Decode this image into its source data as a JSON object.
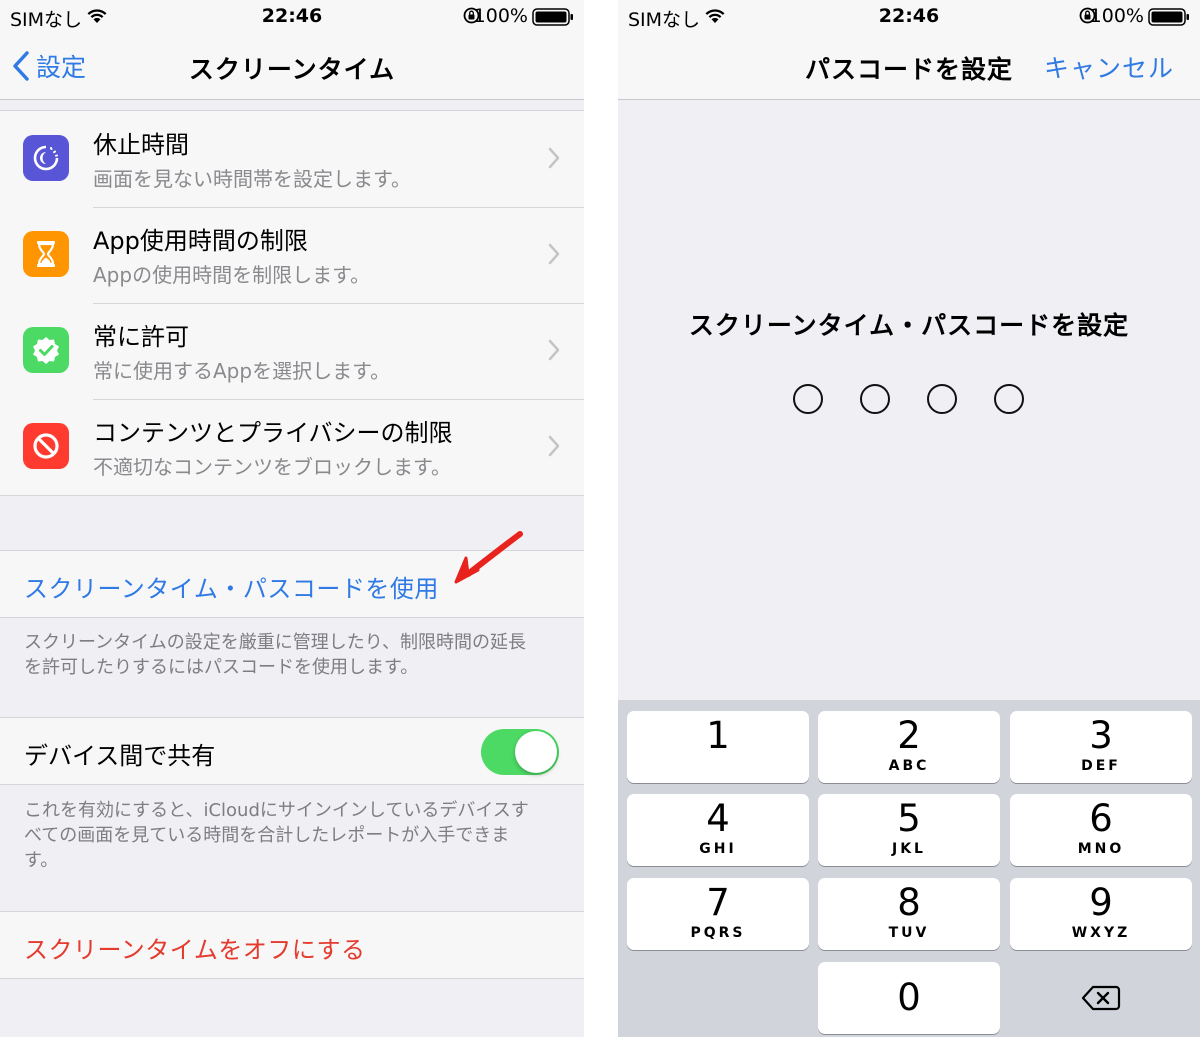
{
  "left": {
    "status": {
      "carrier": "SIMなし",
      "time": "22:46",
      "battery": "100%"
    },
    "nav": {
      "back_label": "設定",
      "title": "スクリーンタイム"
    },
    "features": [
      {
        "title": "休止時間",
        "subtitle": "画面を見ない時間帯を設定します。",
        "icon": "downtime-icon",
        "color": "#5856d6"
      },
      {
        "title": "App使用時間の制限",
        "subtitle": "Appの使用時間を制限します。",
        "icon": "hourglass-icon",
        "color": "#ff9500"
      },
      {
        "title": "常に許可",
        "subtitle": "常に使用するAppを選択します。",
        "icon": "checkmark-badge-icon",
        "color": "#4cd964"
      },
      {
        "title": "コンテンツとプライバシーの制限",
        "subtitle": "不適切なコンテンツをブロックします。",
        "icon": "prohibited-icon",
        "color": "#ff3b30"
      }
    ],
    "passcode_link": "スクリーンタイム・パスコードを使用",
    "passcode_footnote_line1": "スクリーンタイムの設定を厳重に管理したり、制限時間の延長",
    "passcode_footnote_line2": "を許可したりするにはパスコードを使用します。",
    "share_label": "デバイス間で共有",
    "share_enabled": true,
    "share_footnote_line1": "これを有効にすると、iCloudにサインインしているデバイスす",
    "share_footnote_line2": "べての画面を見ている時間を合計したレポートが入手できま",
    "share_footnote_line3": "す。",
    "turn_off_link": "スクリーンタイムをオフにする"
  },
  "right": {
    "status": {
      "carrier": "SIMなし",
      "time": "22:46",
      "battery": "100%"
    },
    "nav": {
      "title": "パスコードを設定",
      "cancel_label": "キャンセル"
    },
    "prompt": "スクリーンタイム・パスコードを設定",
    "passcode_length": 4,
    "keys": [
      {
        "digit": "1",
        "letters": ""
      },
      {
        "digit": "2",
        "letters": "ABC"
      },
      {
        "digit": "3",
        "letters": "DEF"
      },
      {
        "digit": "4",
        "letters": "GHI"
      },
      {
        "digit": "5",
        "letters": "JKL"
      },
      {
        "digit": "6",
        "letters": "MNO"
      },
      {
        "digit": "7",
        "letters": "PQRS"
      },
      {
        "digit": "8",
        "letters": "TUV"
      },
      {
        "digit": "9",
        "letters": "WXYZ"
      },
      {
        "digit": "0",
        "letters": ""
      }
    ]
  },
  "colors": {
    "link_blue": "#2f7ae5",
    "destructive_red": "#e53a2e",
    "toggle_green": "#4cd964",
    "annotation_arrow": "#e8221c"
  }
}
